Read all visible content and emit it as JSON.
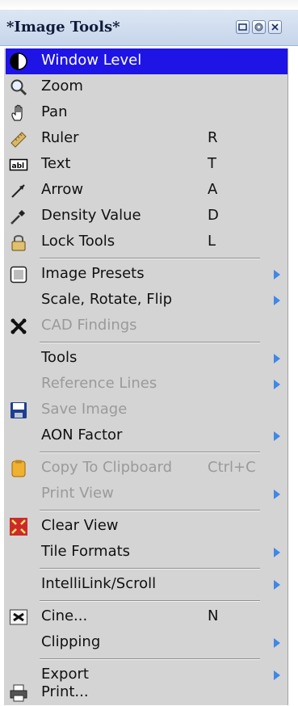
{
  "window": {
    "title": "*Image Tools*"
  },
  "menu": {
    "window_level": "Window Level",
    "zoom": "Zoom",
    "pan": "Pan",
    "ruler": {
      "label": "Ruler",
      "shortcut": "R"
    },
    "text": {
      "label": "Text",
      "shortcut": "T"
    },
    "arrow": {
      "label": "Arrow",
      "shortcut": "A"
    },
    "density_value": {
      "label": "Density Value",
      "shortcut": "D"
    },
    "lock_tools": {
      "label": "Lock Tools",
      "shortcut": "L"
    },
    "image_presets": "Image Presets",
    "scale_rotate_flip": "Scale, Rotate, Flip",
    "cad_findings": "CAD Findings",
    "tools": "Tools",
    "reference_lines": "Reference Lines",
    "save_image": "Save Image",
    "aon_factor": "AON Factor",
    "copy_to_clipboard": {
      "label": "Copy To Clipboard",
      "shortcut": "Ctrl+C"
    },
    "print_view": "Print View",
    "clear_view": "Clear View",
    "tile_formats": "Tile Formats",
    "intellilink_scroll": "IntelliLink/Scroll",
    "cine": {
      "label": "Cine...",
      "shortcut": "N"
    },
    "clipping": "Clipping",
    "export": "Export",
    "print": "Print..."
  },
  "colors": {
    "highlight": "#1e14e6",
    "menu_background": "#d4d4d4",
    "disabled_text": "#9a9a9a",
    "submenu_arrow": "#3f87e8"
  }
}
